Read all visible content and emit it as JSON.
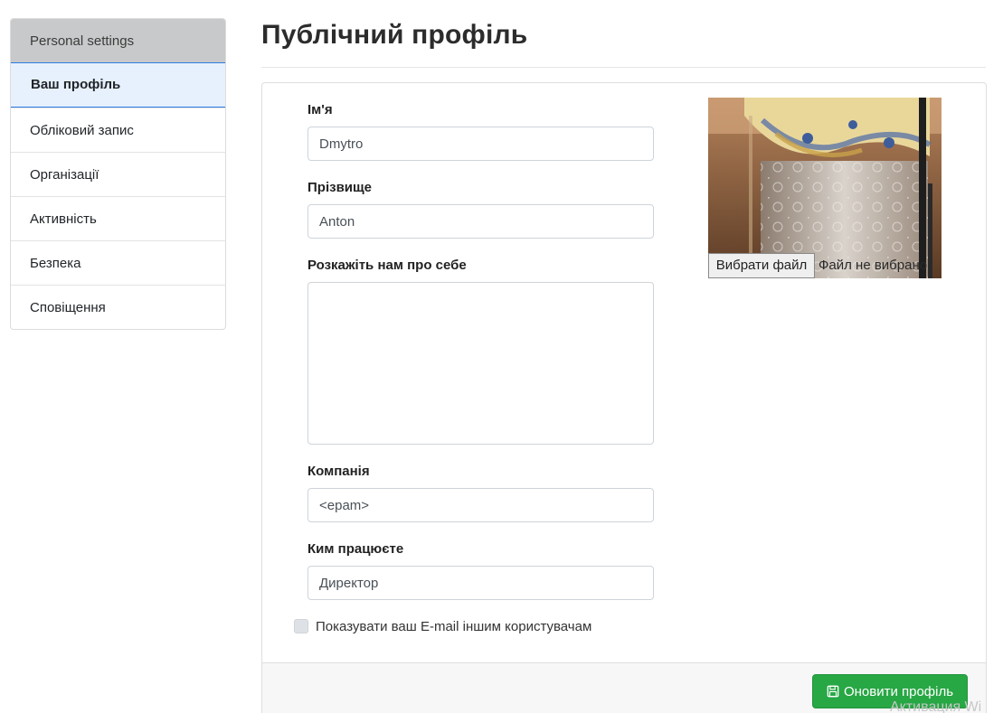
{
  "sidebar": {
    "header": "Personal settings",
    "items": [
      {
        "label": "Ваш профіль",
        "active": true
      },
      {
        "label": "Обліковий запис"
      },
      {
        "label": "Організації"
      },
      {
        "label": "Активність"
      },
      {
        "label": "Безпека"
      },
      {
        "label": "Сповіщення"
      }
    ]
  },
  "page": {
    "title": "Публічний профіль"
  },
  "form": {
    "first_name": {
      "label": "Ім'я",
      "value": "Dmytro"
    },
    "last_name": {
      "label": "Прізвище",
      "value": "Anton"
    },
    "about": {
      "label": "Розкажіть нам про себе",
      "value": ""
    },
    "company": {
      "label": "Компанія",
      "value": "<epam>"
    },
    "position": {
      "label": "Ким працюєте",
      "value": "Директор"
    },
    "show_email": {
      "label": "Показувати ваш E-mail іншим користувачам",
      "checked": false
    }
  },
  "avatar": {
    "choose_file_label": "Вибрати файл",
    "file_status": "Файл не вибрано"
  },
  "footer": {
    "submit_label": "Оновити профіль",
    "submit_icon": "save-icon",
    "submit_color": "#28a745"
  },
  "watermark": "Активация Wi"
}
